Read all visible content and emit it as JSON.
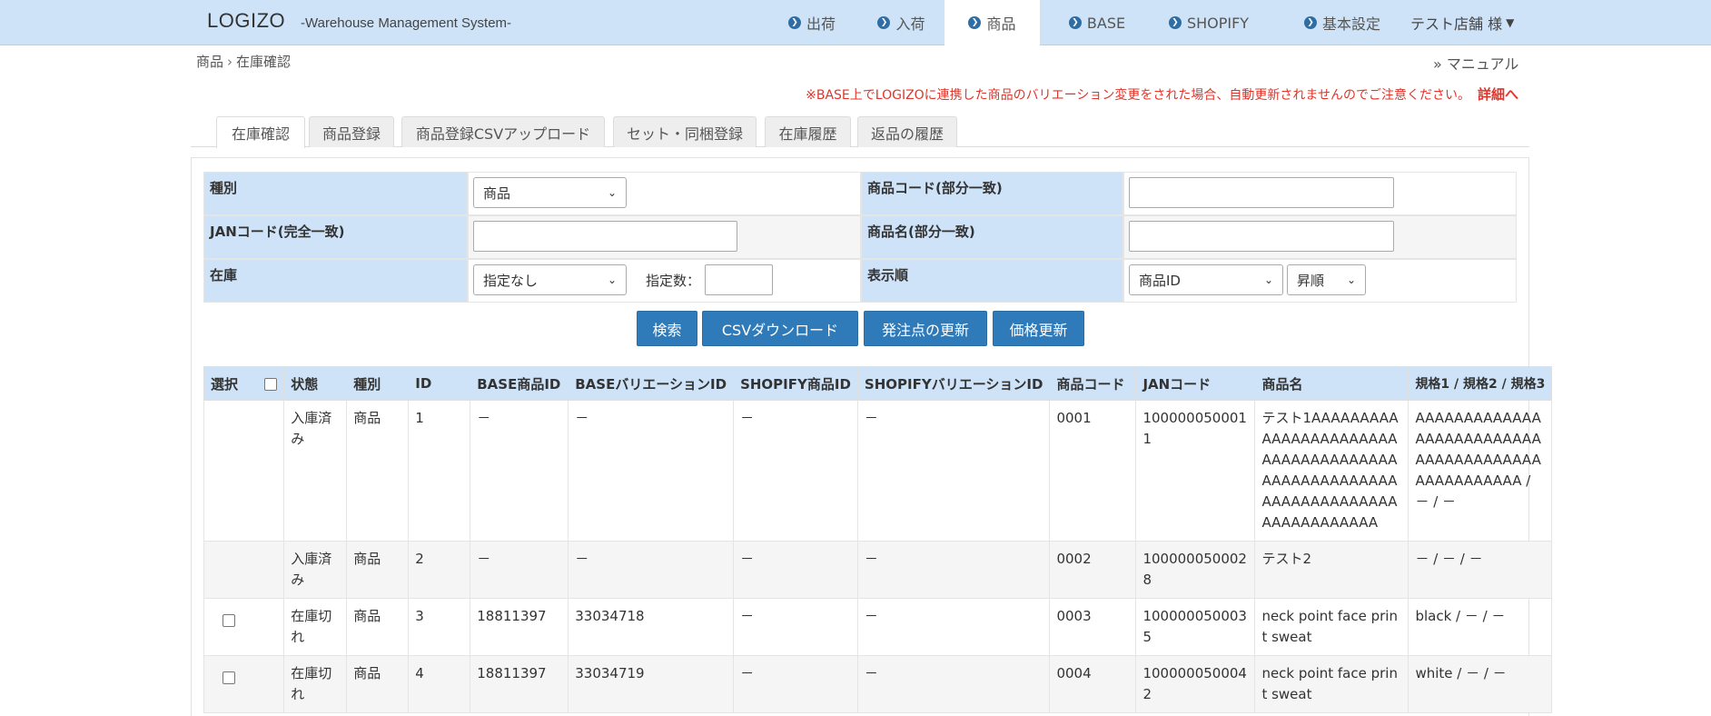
{
  "app": {
    "brand": "LOGIZO",
    "subtitle": "-Warehouse Management System-"
  },
  "nav": {
    "items": [
      {
        "label": "出荷"
      },
      {
        "label": "入荷"
      },
      {
        "label": "商品"
      },
      {
        "label": "BASE"
      },
      {
        "label": "SHOPIFY"
      },
      {
        "label": "基本設定"
      }
    ],
    "active": "商品",
    "user": "テスト店舗 様"
  },
  "breadcrumb": {
    "parent": "商品",
    "separator": "›",
    "current": "在庫確認"
  },
  "manual_link": "» マニュアル",
  "notice": {
    "text": "※BASE上でLOGIZOに連携した商品のバリエーション変更をされた場合、自動更新されませんのでご注意ください。",
    "detail_link": "詳細へ"
  },
  "tabs": [
    {
      "label": "在庫確認"
    },
    {
      "label": "商品登録"
    },
    {
      "label": "商品登録CSVアップロード"
    },
    {
      "label": "セット・同梱登録"
    },
    {
      "label": "在庫履歴"
    },
    {
      "label": "返品の履歴"
    }
  ],
  "search": {
    "type_label": "種別",
    "type_value": "商品",
    "product_code_label": "商品コード(部分一致)",
    "product_code_value": "",
    "jan_label": "JANコード(完全一致)",
    "jan_value": "",
    "name_label": "商品名(部分一致)",
    "name_value": "",
    "stock_label": "在庫",
    "stock_value": "指定なし",
    "count_label": "指定数：",
    "count_value": "",
    "order_label": "表示順",
    "order_value": "商品ID",
    "direction_value": "昇順"
  },
  "buttons": {
    "search": "検索",
    "csv_download": "CSVダウンロード",
    "reorder_update": "発注点の更新",
    "price_update": "価格更新"
  },
  "table": {
    "headers": [
      "選択",
      "状態",
      "種別",
      "ID",
      "BASE商品ID",
      "BASEバリエーションID",
      "SHOPIFY商品ID",
      "SHOPIFYバリエーションID",
      "商品コード",
      "JANコード",
      "商品名",
      "規格1 / 規格2 / 規格3"
    ],
    "rows": [
      {
        "status": "入庫済み",
        "type": "商品",
        "id": "1",
        "base_id": "－",
        "base_var": "－",
        "shopify_id": "－",
        "shopify_var": "－",
        "code": "0001",
        "jan": "1000000500011",
        "name": "テスト1AAAAAAAAAAAAAAAAAAAAAAAAAAAAAAAAAAAAAAAAAAAAAAAAAAAAAAAAAAAAAAAAAAAAAAAAAAAAA",
        "spec": "AAAAAAAAAAAAAAAAAAAAAAAAAAAAAAAAAAAAAAAAAAAAAAAAAA / － / －"
      },
      {
        "status": "入庫済み",
        "type": "商品",
        "id": "2",
        "base_id": "－",
        "base_var": "－",
        "shopify_id": "－",
        "shopify_var": "－",
        "code": "0002",
        "jan": "1000000500028",
        "name": "テスト2",
        "spec": "－ / － / －"
      },
      {
        "status": "在庫切れ",
        "type": "商品",
        "id": "3",
        "base_id": "18811397",
        "base_var": "33034718",
        "shopify_id": "－",
        "shopify_var": "－",
        "code": "0003",
        "jan": "1000000500035",
        "name": "neck point face print sweat",
        "spec": "black / － / －"
      },
      {
        "status": "在庫切れ",
        "type": "商品",
        "id": "4",
        "base_id": "18811397",
        "base_var": "33034719",
        "shopify_id": "－",
        "shopify_var": "－",
        "code": "0004",
        "jan": "1000000500042",
        "name": "neck point face print sweat",
        "spec": "white / － / －"
      }
    ]
  },
  "colors": {
    "navbar_bg": "#cfe3f8",
    "header_bg": "#cfe3f8",
    "button_bg": "#2f7ab8",
    "notice": "#e0352b"
  }
}
